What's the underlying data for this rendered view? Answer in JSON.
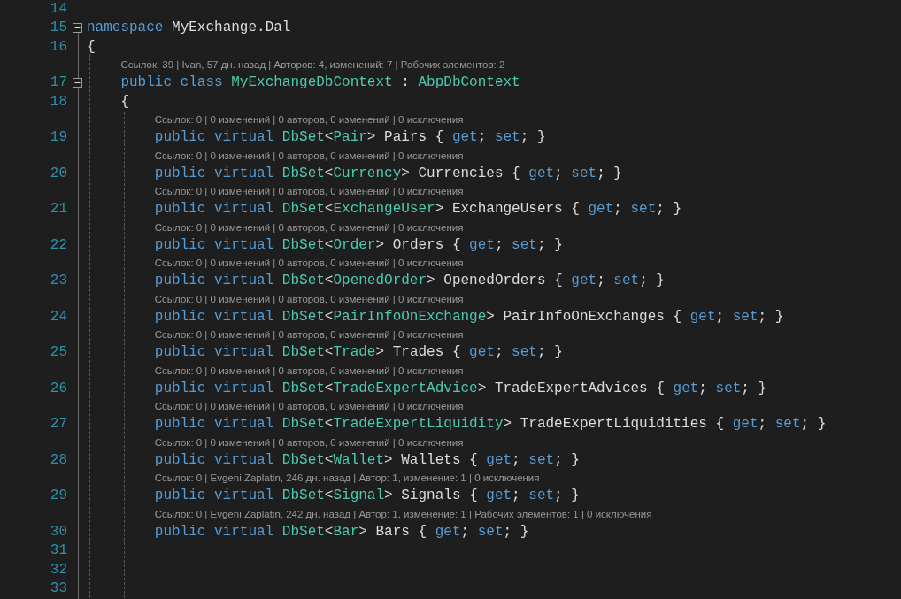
{
  "lines": [
    {
      "number": "14"
    },
    {
      "number": "15",
      "expanded": true,
      "tokens": [
        {
          "kind": "keyword",
          "text": "namespace"
        },
        {
          "kind": "plain",
          "text": " MyExchange.Dal"
        }
      ]
    },
    {
      "number": "16",
      "tokens": [
        {
          "kind": "plain",
          "text": "{"
        }
      ],
      "children": [
        {
          "number": "17",
          "expanded": true,
          "codelens": "Ссылок: 39 | Ivan, 57 дн. назад | Авторов: 4, изменений: 7 | Рабочих элементов: 2",
          "tokens": [
            {
              "kind": "keyword",
              "text": "public class "
            },
            {
              "kind": "type",
              "text": "MyExchangeDbContext"
            },
            {
              "kind": "plain",
              "text": " : "
            },
            {
              "kind": "type",
              "text": "AbpDbContext"
            }
          ]
        },
        {
          "number": "18",
          "tokens": [
            {
              "kind": "plain",
              "text": "{"
            }
          ],
          "children": [
            {
              "number": "19",
              "codelens": "Ссылок: 0 | 0 изменений | 0 авторов, 0 изменений | 0 исключения",
              "tokens": [
                {
                  "kind": "keyword",
                  "text": "public virtual "
                },
                {
                  "kind": "type",
                  "text": "DbSet"
                },
                {
                  "kind": "plain",
                  "text": "<"
                },
                {
                  "kind": "type",
                  "text": "Pair"
                },
                {
                  "kind": "plain",
                  "text": "> Pairs { "
                },
                {
                  "kind": "keyword",
                  "text": "get"
                },
                {
                  "kind": "plain",
                  "text": "; "
                },
                {
                  "kind": "keyword",
                  "text": "set"
                },
                {
                  "kind": "plain",
                  "text": "; }"
                }
              ]
            },
            {
              "number": "20",
              "codelens": "Ссылок: 0 | 0 изменений | 0 авторов, 0 изменений | 0 исключения",
              "tokens": [
                {
                  "kind": "keyword",
                  "text": "public virtual "
                },
                {
                  "kind": "type",
                  "text": "DbSet"
                },
                {
                  "kind": "plain",
                  "text": "<"
                },
                {
                  "kind": "type",
                  "text": "Currency"
                },
                {
                  "kind": "plain",
                  "text": "> Currencies { "
                },
                {
                  "kind": "keyword",
                  "text": "get"
                },
                {
                  "kind": "plain",
                  "text": "; "
                },
                {
                  "kind": "keyword",
                  "text": "set"
                },
                {
                  "kind": "plain",
                  "text": "; }"
                }
              ]
            },
            {
              "number": "21",
              "codelens": "Ссылок: 0 | 0 изменений | 0 авторов, 0 изменений | 0 исключения",
              "tokens": [
                {
                  "kind": "keyword",
                  "text": "public virtual "
                },
                {
                  "kind": "type",
                  "text": "DbSet"
                },
                {
                  "kind": "plain",
                  "text": "<"
                },
                {
                  "kind": "type",
                  "text": "ExchangeUser"
                },
                {
                  "kind": "plain",
                  "text": "> ExchangeUsers { "
                },
                {
                  "kind": "keyword",
                  "text": "get"
                },
                {
                  "kind": "plain",
                  "text": "; "
                },
                {
                  "kind": "keyword",
                  "text": "set"
                },
                {
                  "kind": "plain",
                  "text": "; }"
                }
              ]
            },
            {
              "number": "22",
              "codelens": "Ссылок: 0 | 0 изменений | 0 авторов, 0 изменений | 0 исключения",
              "tokens": [
                {
                  "kind": "keyword",
                  "text": "public virtual "
                },
                {
                  "kind": "type",
                  "text": "DbSet"
                },
                {
                  "kind": "plain",
                  "text": "<"
                },
                {
                  "kind": "type",
                  "text": "Order"
                },
                {
                  "kind": "plain",
                  "text": "> Orders { "
                },
                {
                  "kind": "keyword",
                  "text": "get"
                },
                {
                  "kind": "plain",
                  "text": "; "
                },
                {
                  "kind": "keyword",
                  "text": "set"
                },
                {
                  "kind": "plain",
                  "text": "; }"
                }
              ]
            },
            {
              "number": "23",
              "codelens": "Ссылок: 0 | 0 изменений | 0 авторов, 0 изменений | 0 исключения",
              "tokens": [
                {
                  "kind": "keyword",
                  "text": "public virtual "
                },
                {
                  "kind": "type",
                  "text": "DbSet"
                },
                {
                  "kind": "plain",
                  "text": "<"
                },
                {
                  "kind": "type",
                  "text": "OpenedOrder"
                },
                {
                  "kind": "plain",
                  "text": "> OpenedOrders { "
                },
                {
                  "kind": "keyword",
                  "text": "get"
                },
                {
                  "kind": "plain",
                  "text": "; "
                },
                {
                  "kind": "keyword",
                  "text": "set"
                },
                {
                  "kind": "plain",
                  "text": "; }"
                }
              ]
            },
            {
              "number": "24",
              "codelens": "Ссылок: 0 | 0 изменений | 0 авторов, 0 изменений | 0 исключения",
              "tokens": [
                {
                  "kind": "keyword",
                  "text": "public virtual "
                },
                {
                  "kind": "type",
                  "text": "DbSet"
                },
                {
                  "kind": "plain",
                  "text": "<"
                },
                {
                  "kind": "type",
                  "text": "PairInfoOnExchange"
                },
                {
                  "kind": "plain",
                  "text": "> PairInfoOnExchanges { "
                },
                {
                  "kind": "keyword",
                  "text": "get"
                },
                {
                  "kind": "plain",
                  "text": "; "
                },
                {
                  "kind": "keyword",
                  "text": "set"
                },
                {
                  "kind": "plain",
                  "text": "; }"
                }
              ]
            },
            {
              "number": "25",
              "codelens": "Ссылок: 0 | 0 изменений | 0 авторов, 0 изменений | 0 исключения",
              "tokens": [
                {
                  "kind": "keyword",
                  "text": "public virtual "
                },
                {
                  "kind": "type",
                  "text": "DbSet"
                },
                {
                  "kind": "plain",
                  "text": "<"
                },
                {
                  "kind": "type",
                  "text": "Trade"
                },
                {
                  "kind": "plain",
                  "text": "> Trades { "
                },
                {
                  "kind": "keyword",
                  "text": "get"
                },
                {
                  "kind": "plain",
                  "text": "; "
                },
                {
                  "kind": "keyword",
                  "text": "set"
                },
                {
                  "kind": "plain",
                  "text": "; }"
                }
              ]
            },
            {
              "number": "26",
              "codelens": "Ссылок: 0 | 0 изменений | 0 авторов, 0 изменений | 0 исключения",
              "tokens": [
                {
                  "kind": "keyword",
                  "text": "public virtual "
                },
                {
                  "kind": "type",
                  "text": "DbSet"
                },
                {
                  "kind": "plain",
                  "text": "<"
                },
                {
                  "kind": "type",
                  "text": "TradeExpertAdvice"
                },
                {
                  "kind": "plain",
                  "text": "> TradeExpertAdvices { "
                },
                {
                  "kind": "keyword",
                  "text": "get"
                },
                {
                  "kind": "plain",
                  "text": "; "
                },
                {
                  "kind": "keyword",
                  "text": "set"
                },
                {
                  "kind": "plain",
                  "text": "; }"
                }
              ]
            },
            {
              "number": "27",
              "codelens": "Ссылок: 0 | 0 изменений | 0 авторов, 0 изменений | 0 исключения",
              "tokens": [
                {
                  "kind": "keyword",
                  "text": "public virtual "
                },
                {
                  "kind": "type",
                  "text": "DbSet"
                },
                {
                  "kind": "plain",
                  "text": "<"
                },
                {
                  "kind": "type",
                  "text": "TradeExpertLiquidity"
                },
                {
                  "kind": "plain",
                  "text": "> TradeExpertLiquidities { "
                },
                {
                  "kind": "keyword",
                  "text": "get"
                },
                {
                  "kind": "plain",
                  "text": "; "
                },
                {
                  "kind": "keyword",
                  "text": "set"
                },
                {
                  "kind": "plain",
                  "text": "; }"
                }
              ]
            },
            {
              "number": "28",
              "codelens": "Ссылок: 0 | 0 изменений | 0 авторов, 0 изменений | 0 исключения",
              "tokens": [
                {
                  "kind": "keyword",
                  "text": "public virtual "
                },
                {
                  "kind": "type",
                  "text": "DbSet"
                },
                {
                  "kind": "plain",
                  "text": "<"
                },
                {
                  "kind": "type",
                  "text": "Wallet"
                },
                {
                  "kind": "plain",
                  "text": "> Wallets { "
                },
                {
                  "kind": "keyword",
                  "text": "get"
                },
                {
                  "kind": "plain",
                  "text": "; "
                },
                {
                  "kind": "keyword",
                  "text": "set"
                },
                {
                  "kind": "plain",
                  "text": "; }"
                }
              ]
            },
            {
              "number": "29",
              "codelens": "Ссылок: 0 | Evgeni Zaplatin, 246 дн. назад | Автор: 1, изменение: 1 | 0 исключения",
              "tokens": [
                {
                  "kind": "keyword",
                  "text": "public virtual "
                },
                {
                  "kind": "type",
                  "text": "DbSet"
                },
                {
                  "kind": "plain",
                  "text": "<"
                },
                {
                  "kind": "type",
                  "text": "Signal"
                },
                {
                  "kind": "plain",
                  "text": "> Signals { "
                },
                {
                  "kind": "keyword",
                  "text": "get"
                },
                {
                  "kind": "plain",
                  "text": "; "
                },
                {
                  "kind": "keyword",
                  "text": "set"
                },
                {
                  "kind": "plain",
                  "text": "; }"
                }
              ]
            },
            {
              "number": "30",
              "codelens": "Ссылок: 0 | Evgeni Zaplatin, 242 дн. назад | Автор: 1, изменение: 1 | Рабочих элементов: 1 | 0 исключения",
              "tokens": [
                {
                  "kind": "keyword",
                  "text": "public virtual "
                },
                {
                  "kind": "type",
                  "text": "DbSet"
                },
                {
                  "kind": "plain",
                  "text": "<"
                },
                {
                  "kind": "type",
                  "text": "Bar"
                },
                {
                  "kind": "plain",
                  "text": "> Bars { "
                },
                {
                  "kind": "keyword",
                  "text": "get"
                },
                {
                  "kind": "plain",
                  "text": "; "
                },
                {
                  "kind": "keyword",
                  "text": "set"
                },
                {
                  "kind": "plain",
                  "text": "; }"
                }
              ]
            }
          ]
        }
      ]
    },
    {
      "number": "31"
    },
    {
      "number": "32"
    },
    {
      "number": "33"
    }
  ]
}
